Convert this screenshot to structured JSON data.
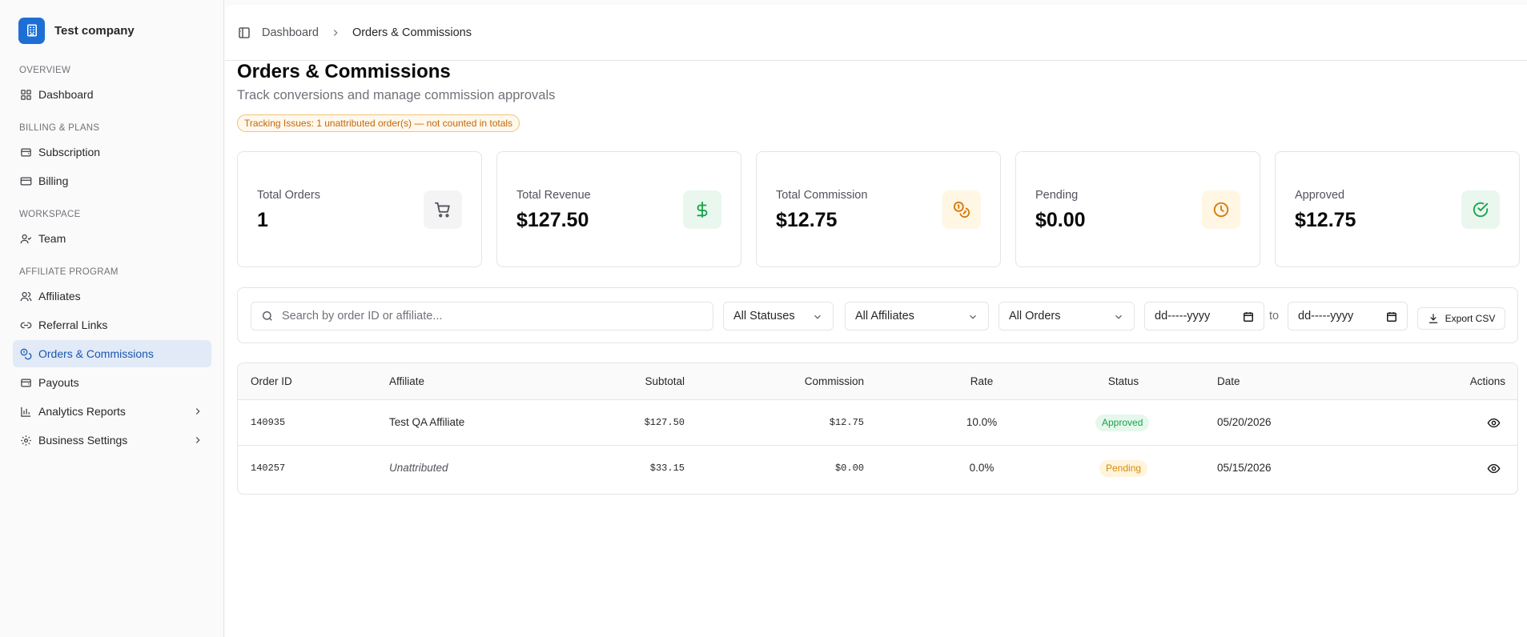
{
  "sidebar": {
    "company": "Test company",
    "sections": {
      "overview": "OVERVIEW",
      "billing": "BILLING & PLANS",
      "workspace": "WORKSPACE",
      "affiliate": "AFFILIATE PROGRAM"
    },
    "items": {
      "dashboard": "Dashboard",
      "subscription": "Subscription",
      "billing": "Billing",
      "team": "Team",
      "affiliates": "Affiliates",
      "referral_links": "Referral Links",
      "orders": "Orders & Commissions",
      "payouts": "Payouts",
      "analytics": "Analytics Reports",
      "business_settings": "Business Settings"
    }
  },
  "breadcrumb": {
    "parent": "Dashboard",
    "current": "Orders & Commissions"
  },
  "page": {
    "title": "Orders & Commissions",
    "subtitle": "Track conversions and manage commission approvals",
    "warning": "Tracking Issues: 1 unattributed order(s) — not counted in totals"
  },
  "stats": [
    {
      "label": "Total Orders",
      "value": "1",
      "icon": "cart-icon",
      "color": "#52525b"
    },
    {
      "label": "Total Revenue",
      "value": "$127.50",
      "icon": "dollar-icon",
      "color": "#16a34a"
    },
    {
      "label": "Total Commission",
      "value": "$12.75",
      "icon": "coins-icon",
      "color": "#d97706"
    },
    {
      "label": "Pending",
      "value": "$0.00",
      "icon": "clock-icon",
      "color": "#d97706"
    },
    {
      "label": "Approved",
      "value": "$12.75",
      "icon": "check-circle-icon",
      "color": "#16a34a"
    }
  ],
  "filters": {
    "search_placeholder": "Search by order ID or affiliate...",
    "status": "All Statuses",
    "affiliate": "All Affiliates",
    "orders": "All Orders",
    "date_from": "dd-----yyyy",
    "to": "to",
    "date_to": "dd-----yyyy",
    "export": "Export CSV"
  },
  "table": {
    "headers": {
      "order_id": "Order ID",
      "affiliate": "Affiliate",
      "subtotal": "Subtotal",
      "commission": "Commission",
      "rate": "Rate",
      "status": "Status",
      "date": "Date",
      "actions": "Actions"
    },
    "rows": [
      {
        "order_id": "140935",
        "affiliate": "Test QA Affiliate",
        "subtotal": "$127.50",
        "commission": "$12.75",
        "rate": "10.0%",
        "status": "Approved",
        "date": "05/20/2026"
      },
      {
        "order_id": "140257",
        "affiliate": "Unattributed",
        "subtotal": "$33.15",
        "commission": "$0.00",
        "rate": "0.0%",
        "status": "Pending",
        "date": "05/15/2026"
      }
    ]
  },
  "colors": {
    "accent": "#1d6fd6",
    "approved": "#16a34a",
    "pending": "#d98a06"
  }
}
